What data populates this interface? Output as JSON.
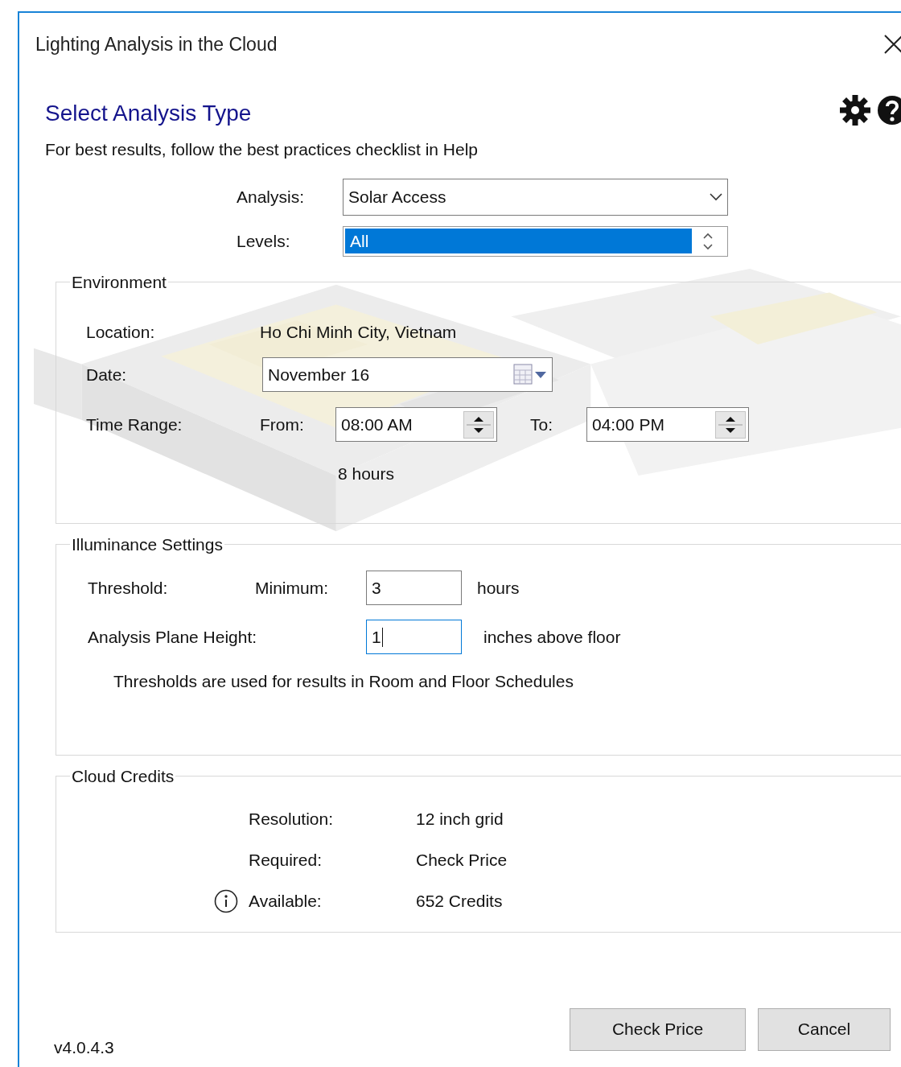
{
  "window": {
    "title": "Lighting Analysis in the Cloud"
  },
  "header": {
    "title": "Select Analysis Type",
    "subtitle": "For best results, follow the best practices checklist in Help"
  },
  "analysis": {
    "label": "Analysis:",
    "value": "Solar Access"
  },
  "levels": {
    "label": "Levels:",
    "items": [
      {
        "label": "All",
        "selected": true
      }
    ]
  },
  "environment": {
    "legend": "Environment",
    "location_label": "Location:",
    "location": "Ho Chi Minh City, Vietnam",
    "date_label": "Date:",
    "date": "November 16",
    "time_label": "Time Range:",
    "from_label": "From:",
    "from": "08:00 AM",
    "to_label": "To:",
    "to": "04:00 PM",
    "duration": "8 hours"
  },
  "illuminance": {
    "legend": "Illuminance Settings",
    "threshold_label": "Threshold:",
    "minimum_label": "Minimum:",
    "minimum": {
      "value": "3",
      "focused": false
    },
    "minimum_unit": "hours",
    "height_label": "Analysis Plane Height:",
    "height": {
      "value": "1",
      "focused": true
    },
    "height_unit": "inches above floor",
    "note": "Thresholds are used for results in Room and Floor Schedules"
  },
  "credits": {
    "legend": "Cloud Credits",
    "rows": [
      {
        "label": "Resolution:",
        "value": "12 inch grid",
        "info": false
      },
      {
        "label": "Required:",
        "value": "Check Price",
        "info": false
      },
      {
        "label": "Available:",
        "value": "652 Credits",
        "info": true
      }
    ]
  },
  "version": "v4.0.4.3",
  "buttons": [
    {
      "label": "Check Price"
    },
    {
      "label": "Cancel"
    }
  ]
}
